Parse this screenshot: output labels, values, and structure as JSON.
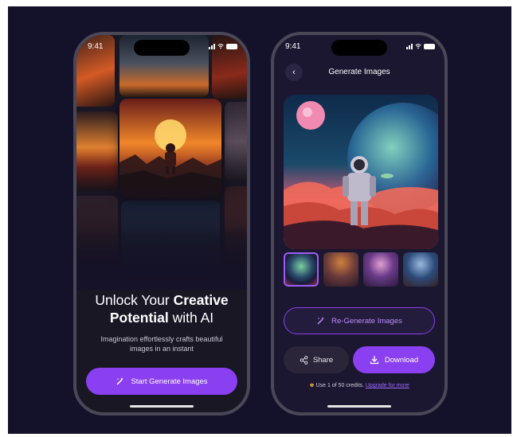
{
  "status_bar": {
    "time": "9:41"
  },
  "onboarding": {
    "title_pre": "Unlock Your ",
    "title_bold1": "Creative",
    "title_bold2": "Potential",
    "title_post": " with AI",
    "subtitle_line1": "Imagination effortlessly crafts beautiful",
    "subtitle_line2": "images in an instant",
    "cta_label": "Start Generate Images"
  },
  "generate": {
    "header_title": "Generate Images",
    "regenerate_label": "Re-Generate Images",
    "share_label": "Share",
    "download_label": "Download",
    "credits_text": "Use 1 of 50 credits.",
    "upgrade_link": "Upgrade for more"
  },
  "colors": {
    "accent": "#8a3ff0",
    "background": "#14122a"
  }
}
